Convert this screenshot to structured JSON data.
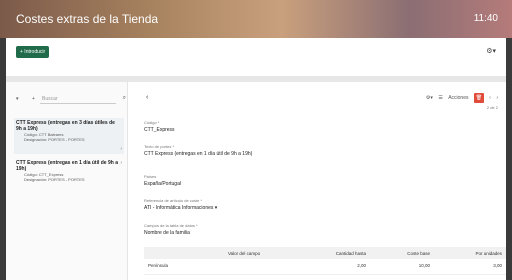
{
  "window": {
    "title": "Costes extras de la Tienda",
    "time": "11:40"
  },
  "toolbar": {
    "add_label": "+ Introducir",
    "settings_icon": "gear-icon"
  },
  "sidebar": {
    "dropdown": "▾",
    "control": "+",
    "search_placeholder": "Buscar",
    "items": [
      {
        "name": "CTT Express (entregas en 3 días útiles de 9h a 19h)",
        "code": "Código: CTT Baleares",
        "designation": "Designación: PORTES - PORTES"
      },
      {
        "name": "CTT Express (entregas en 1 día útil de 9h a 19h)",
        "code": "Código: CTT_Express",
        "designation": "Designación: PORTES - PORTES"
      }
    ]
  },
  "detail": {
    "back": "‹",
    "actions_label": "Acciones",
    "delete_icon": "trash-icon",
    "pager_label": "2 de 2",
    "fields": [
      {
        "label": "Código *",
        "value": "CTT_Express"
      },
      {
        "label": "Texto de portes *",
        "value": "CTT Express (entregas en 1 día útil de 9h a 19h)"
      },
      {
        "label": "Países",
        "value": "España/Portugal"
      },
      {
        "label": "Referencia de artículo de coste *",
        "value": "ATI - Informática Informaciones ▾"
      },
      {
        "label": "Campos de la tabla de datos *",
        "value": "Nombre de la familia"
      }
    ],
    "table": {
      "headers": [
        "Valor del campo",
        "Cantidad hasta",
        "Coste base",
        "Por unidades"
      ],
      "rows": [
        [
          "Península",
          "2,00",
          "10,00",
          "3,00"
        ]
      ]
    }
  }
}
